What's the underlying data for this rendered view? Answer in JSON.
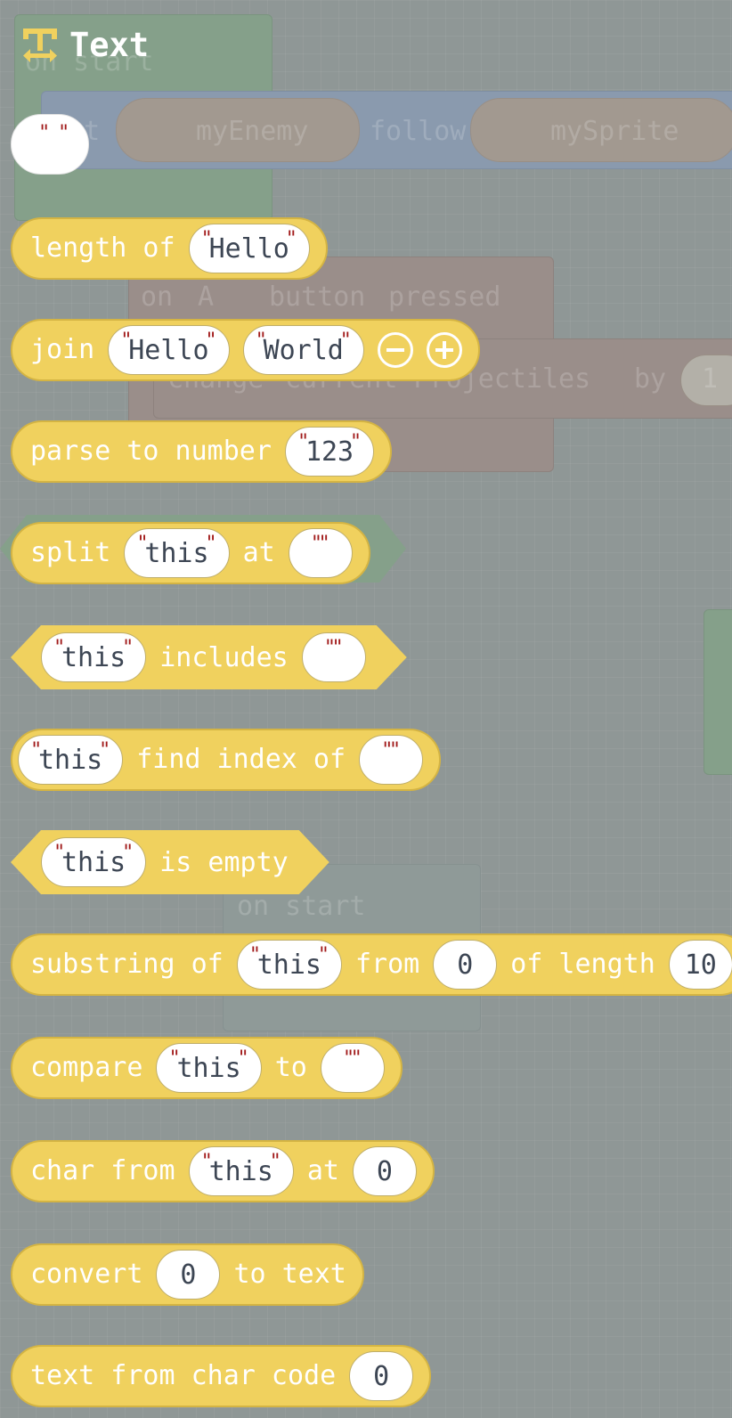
{
  "workspace": {
    "on_start_1": "on start",
    "set_prefix": "set",
    "my_enemy": "myEnemy",
    "follow": "follow",
    "my_sprite": "mySprite",
    "on": "on",
    "button_key": "A",
    "button": "button",
    "pressed": "pressed",
    "change": "change",
    "current_projectiles": "current Projectiles",
    "by": "by",
    "by_value": "1",
    "on_start_2": "on start"
  },
  "flyout": {
    "title": "Text",
    "category_color": "#f0d15e",
    "blocks": {
      "empty_string": {
        "quote": "\""
      },
      "length_of": {
        "label": "length of",
        "arg": "Hello"
      },
      "join": {
        "label": "join",
        "arg1": "Hello",
        "arg2": "World",
        "minus_icon": "minus-circle-icon",
        "plus_icon": "plus-circle-icon"
      },
      "parse_to_number": {
        "label": "parse to number",
        "arg": "123"
      },
      "split": {
        "label": "split",
        "arg": "this",
        "at": "at"
      },
      "includes": {
        "arg": "this",
        "label": "includes"
      },
      "find_index": {
        "arg": "this",
        "label": "find index of"
      },
      "is_empty": {
        "arg": "this",
        "label": "is empty"
      },
      "substring": {
        "label": "substring of",
        "arg": "this",
        "from": "from",
        "from_value": "0",
        "of_length": "of length",
        "length_value": "10"
      },
      "compare": {
        "label": "compare",
        "arg": "this",
        "to": "to"
      },
      "char_from": {
        "label": "char from",
        "arg": "this",
        "at": "at",
        "index": "0"
      },
      "convert": {
        "label": "convert",
        "value": "0",
        "suffix": "to text"
      },
      "text_from_char_code": {
        "label": "text from char code",
        "value": "0"
      }
    }
  }
}
